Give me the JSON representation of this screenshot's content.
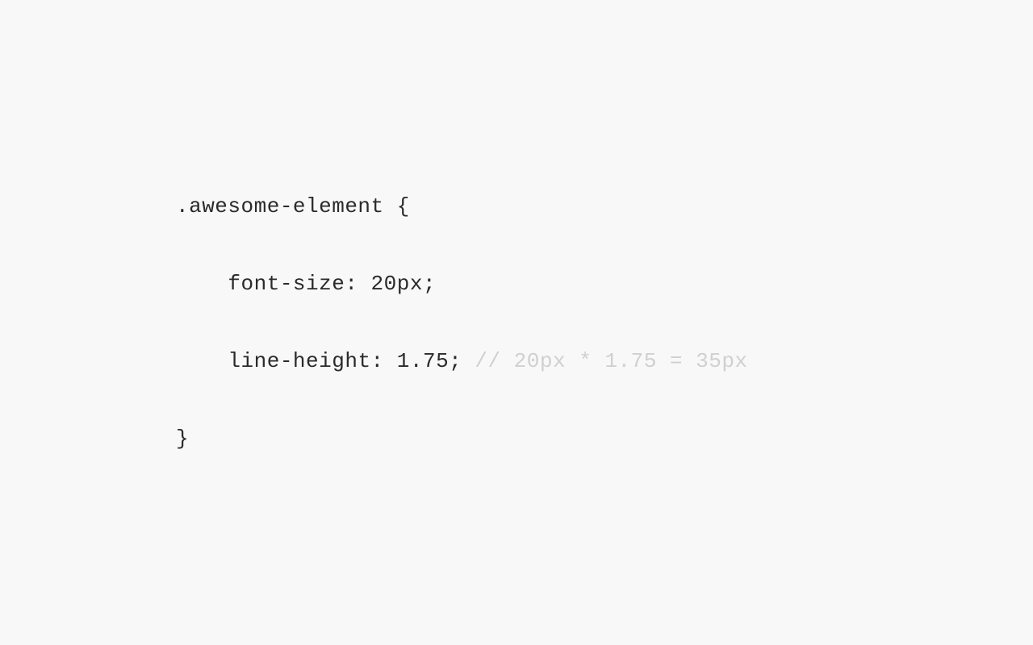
{
  "code": {
    "line1": ".awesome-element {",
    "line2_indent": "    ",
    "line2_text": "font-size: 20px;",
    "line3_indent": "    ",
    "line3_text": "line-height: 1.75; ",
    "line3_comment": "// 20px * 1.75 = 35px",
    "line4": "}"
  }
}
